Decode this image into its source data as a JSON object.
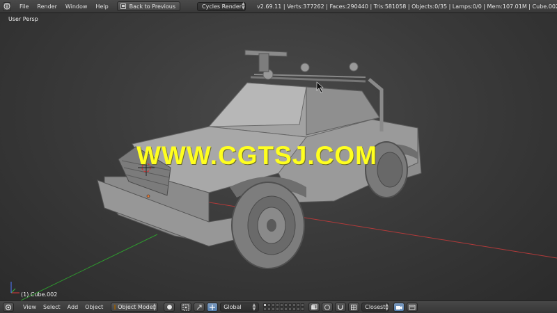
{
  "topbar": {
    "menus": [
      "File",
      "Render",
      "Window",
      "Help"
    ],
    "back_button": "Back to Previous",
    "render_engine": "Cycles Render",
    "stats": "v2.69.11 | Verts:377262 | Faces:290440 | Tris:581058 | Objects:0/35 | Lamps:0/0 | Mem:107.01M | Cube.002"
  },
  "viewport": {
    "view_label": "User Persp",
    "object_label": "(1) Cube.002",
    "watermark": "WWW.CGTSJ.COM",
    "gizmo_axes": [
      "X",
      "Y",
      "Z"
    ]
  },
  "bottombar": {
    "menus": [
      "View",
      "Select",
      "Add",
      "Object"
    ],
    "mode": "Object Mode",
    "orientation": "Global",
    "snap_target": "Closest"
  },
  "colors": {
    "watermark": "#ffff1f",
    "x_axis": "#c23a3a",
    "y_axis": "#3cae3c",
    "z_axis": "#4a6ee0",
    "mode_cube": "#e8a23a"
  }
}
